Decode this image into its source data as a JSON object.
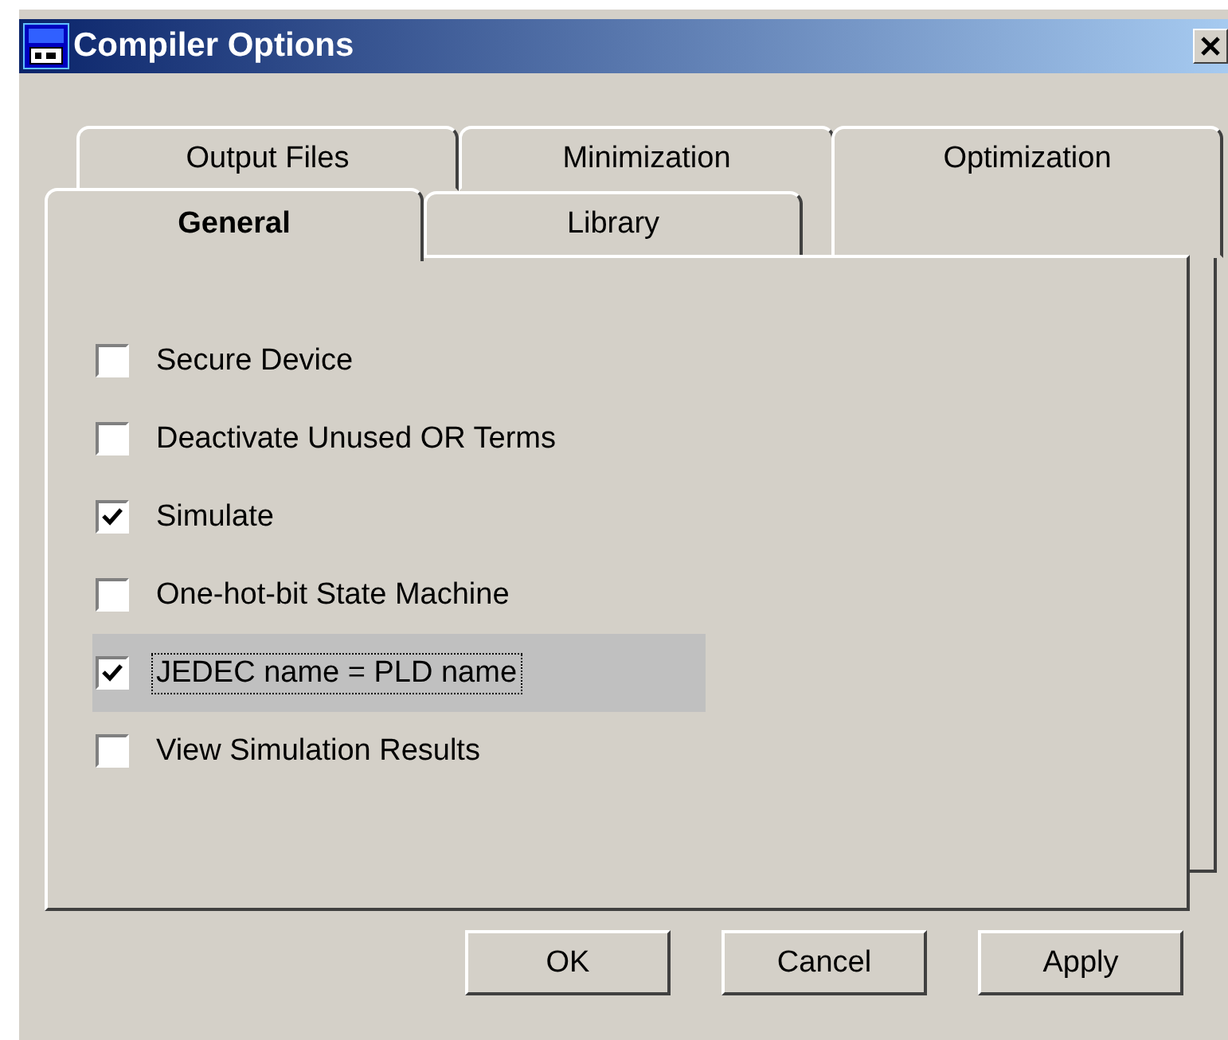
{
  "window": {
    "title": "Compiler Options"
  },
  "tab_rows": [
    [
      {
        "label": "Output Files",
        "selected": false
      },
      {
        "label": "Minimization",
        "selected": false
      },
      {
        "label": "Optimization",
        "selected": false
      }
    ],
    [
      {
        "label": "General",
        "selected": true
      },
      {
        "label": "Library",
        "selected": false
      }
    ]
  ],
  "options": [
    {
      "label": "Secure Device",
      "checked": false,
      "focused": false
    },
    {
      "label": "Deactivate Unused OR Terms",
      "checked": false,
      "focused": false
    },
    {
      "label": "Simulate",
      "checked": true,
      "focused": false
    },
    {
      "label": "One-hot-bit State Machine",
      "checked": false,
      "focused": false
    },
    {
      "label": "JEDEC name = PLD name",
      "checked": true,
      "focused": true
    },
    {
      "label": "View Simulation Results",
      "checked": false,
      "focused": false
    }
  ],
  "buttons": [
    "OK",
    "Cancel",
    "Apply"
  ]
}
